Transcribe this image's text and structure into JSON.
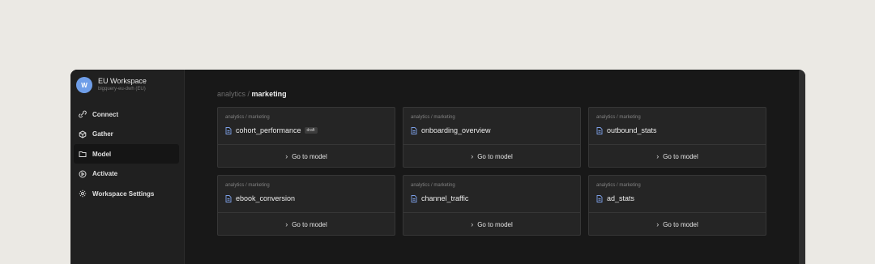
{
  "workspace": {
    "avatar": "W",
    "name": "EU Workspace",
    "subtitle": "bigquery-eu-dwh (EU)"
  },
  "nav": [
    {
      "label": "Connect",
      "icon": "connect-icon",
      "active": false
    },
    {
      "label": "Gather",
      "icon": "cube-icon",
      "active": false
    },
    {
      "label": "Model",
      "icon": "folder-icon",
      "active": true
    },
    {
      "label": "Activate",
      "icon": "play-circle-icon",
      "active": false
    },
    {
      "label": "Workspace Settings",
      "icon": "gear-icon",
      "active": false
    }
  ],
  "breadcrumb": {
    "parent": "analytics /",
    "current": "marketing"
  },
  "cards": [
    {
      "path": "analytics / marketing",
      "title": "cohort_performance",
      "badge": "draft",
      "action": "Go to model"
    },
    {
      "path": "analytics / marketing",
      "title": "onboarding_overview",
      "action": "Go to model"
    },
    {
      "path": "analytics / marketing",
      "title": "outbound_stats",
      "action": "Go to model"
    },
    {
      "path": "analytics / marketing",
      "title": "ebook_conversion",
      "action": "Go to model"
    },
    {
      "path": "analytics / marketing",
      "title": "channel_traffic",
      "action": "Go to model"
    },
    {
      "path": "analytics / marketing",
      "title": "ad_stats",
      "action": "Go to model"
    }
  ],
  "colors": {
    "accent": "#6f9ee8",
    "file_icon": "#7c9fe6"
  }
}
